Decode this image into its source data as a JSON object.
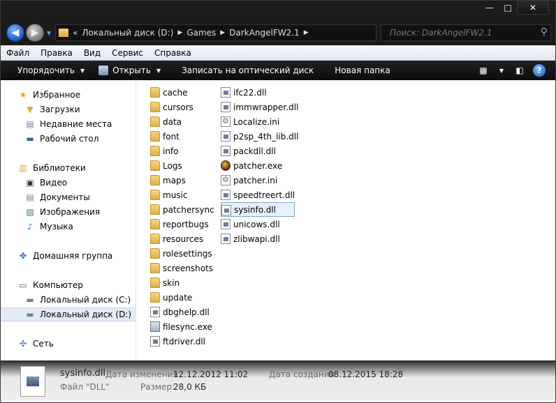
{
  "window": {
    "minimize": "—",
    "maximize": "□",
    "close": "✕"
  },
  "address": {
    "overflow": "«",
    "crumbs": [
      "Локальный диск (D:)",
      "Games",
      "DarkAngelFW2.1"
    ]
  },
  "search": {
    "placeholder": "Поиск: DarkAngelFW2.1"
  },
  "menu": [
    "Файл",
    "Правка",
    "Вид",
    "Сервис",
    "Справка"
  ],
  "toolbar": {
    "organize": "Упорядочить",
    "open": "Открыть",
    "burn": "Записать на оптический диск",
    "new_folder": "Новая папка",
    "help": "?"
  },
  "nav": {
    "favorites": "Избранное",
    "downloads": "Загрузки",
    "recent": "Недавние места",
    "desktop": "Рабочий стол",
    "libraries": "Библиотеки",
    "video": "Видео",
    "documents": "Документы",
    "images": "Изображения",
    "music": "Музыка",
    "homegroup": "Домашняя группа",
    "computer": "Компьютер",
    "disk_c": "Локальный диск (C:)",
    "disk_d": "Локальный диск (D:)",
    "network": "Сеть"
  },
  "files_col1": [
    {
      "name": "cache",
      "type": "folder"
    },
    {
      "name": "cursors",
      "type": "folder"
    },
    {
      "name": "data",
      "type": "folder"
    },
    {
      "name": "font",
      "type": "folder"
    },
    {
      "name": "info",
      "type": "folder"
    },
    {
      "name": "Logs",
      "type": "folder"
    },
    {
      "name": "maps",
      "type": "folder"
    },
    {
      "name": "music",
      "type": "folder"
    },
    {
      "name": "patchersync",
      "type": "folder"
    },
    {
      "name": "reportbugs",
      "type": "folder"
    },
    {
      "name": "resources",
      "type": "folder"
    },
    {
      "name": "rolesettings",
      "type": "folder"
    },
    {
      "name": "screenshots",
      "type": "folder"
    },
    {
      "name": "skin",
      "type": "folder"
    },
    {
      "name": "update",
      "type": "folder"
    },
    {
      "name": "dbghelp.dll",
      "type": "dll"
    },
    {
      "name": "filesync.exe",
      "type": "app"
    },
    {
      "name": "ftdriver.dll",
      "type": "dll"
    }
  ],
  "files_col2": [
    {
      "name": "ifc22.dll",
      "type": "dll"
    },
    {
      "name": "immwrapper.dll",
      "type": "dll"
    },
    {
      "name": "Localize.ini",
      "type": "ini"
    },
    {
      "name": "p2sp_4th_lib.dll",
      "type": "dll"
    },
    {
      "name": "packdll.dll",
      "type": "dll"
    },
    {
      "name": "patcher.exe",
      "type": "exe"
    },
    {
      "name": "patcher.ini",
      "type": "ini"
    },
    {
      "name": "speedtreert.dll",
      "type": "dll"
    },
    {
      "name": "sysinfo.dll",
      "type": "dll",
      "selected": true
    },
    {
      "name": "unicows.dll",
      "type": "dll"
    },
    {
      "name": "zlibwapi.dll",
      "type": "dll"
    }
  ],
  "details": {
    "name": "sysinfo.dll",
    "modified_label": "Дата изменения:",
    "modified": "12.12.2012 11:02",
    "created_label": "Дата создания:",
    "created": "08.12.2015 18:28",
    "type_label": "Файл \"DLL\"",
    "size_label": "Размер:",
    "size": "28,0 КБ"
  }
}
